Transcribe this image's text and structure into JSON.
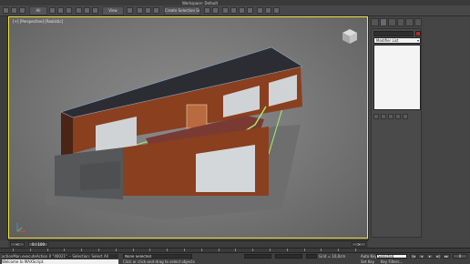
{
  "app": {
    "title_fragment": "Workspace: Default",
    "colors": {
      "viewport_border": "#f2e53d",
      "selection_green": "#a6f06a",
      "roof": "#2b2d33",
      "wood": "#8a3f1f"
    }
  },
  "toolbar": {
    "select_filter": "All",
    "view_dropdown": "View",
    "create_selection_set": "Create Selection Set"
  },
  "viewport": {
    "label": "[+] [Perspective] [Realistic]",
    "icons": {
      "viewcube": "viewcube-icon",
      "axis": "axis-tripod-icon"
    }
  },
  "command_panel": {
    "modifier_list_label": "Modifier List",
    "object_color": "#b22c2c"
  },
  "time_slider": {
    "label": "0 / 100"
  },
  "timeline": {
    "ticks": [
      "0",
      "5",
      "10",
      "15",
      "20",
      "25",
      "30",
      "35",
      "40",
      "45",
      "50",
      "55",
      "60",
      "65",
      "70",
      "75",
      "80",
      "85",
      "90",
      "95",
      "100"
    ]
  },
  "status": {
    "maxscript_line": "actionMan.executeAction 0 \"40021\"  -- Selection: Select All",
    "welcome": "Welcome to MAXScript.",
    "selection_count": "None Selected",
    "prompt": "Click or click-and-drag to select objects",
    "grid": "Grid = 10,0cm",
    "auto_key": "Auto Key",
    "key_mode": "Selected",
    "set_key": "Set Key",
    "key_filters": "Key Filters..."
  }
}
